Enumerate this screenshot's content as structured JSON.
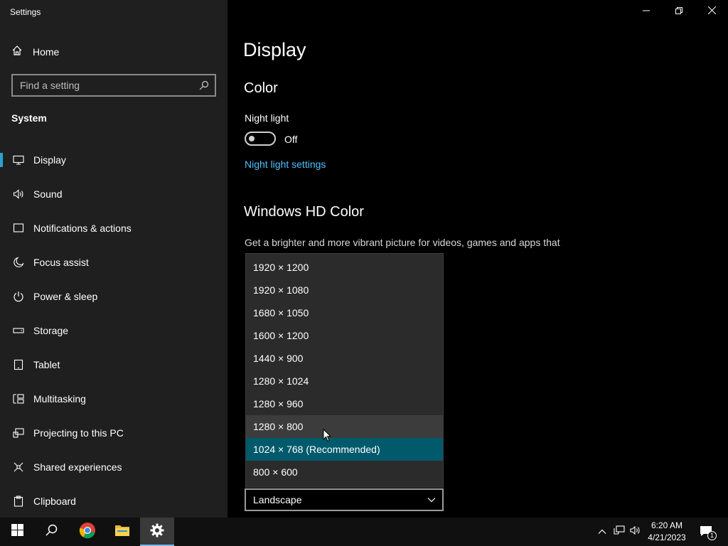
{
  "window": {
    "title": "Settings"
  },
  "sidebar": {
    "home_label": "Home",
    "search_placeholder": "Find a setting",
    "section": "System",
    "items": [
      {
        "label": "Display",
        "icon": "monitor-icon",
        "active": true
      },
      {
        "label": "Sound",
        "icon": "speaker-icon"
      },
      {
        "label": "Notifications & actions",
        "icon": "notification-icon"
      },
      {
        "label": "Focus assist",
        "icon": "moon-icon"
      },
      {
        "label": "Power & sleep",
        "icon": "power-icon"
      },
      {
        "label": "Storage",
        "icon": "storage-icon"
      },
      {
        "label": "Tablet",
        "icon": "tablet-icon"
      },
      {
        "label": "Multitasking",
        "icon": "multitasking-icon"
      },
      {
        "label": "Projecting to this PC",
        "icon": "projecting-icon"
      },
      {
        "label": "Shared experiences",
        "icon": "shared-icon"
      },
      {
        "label": "Clipboard",
        "icon": "clipboard-icon"
      }
    ]
  },
  "main": {
    "title": "Display",
    "color_heading": "Color",
    "night_light_label": "Night light",
    "night_light_state": "Off",
    "night_light_link": "Night light settings",
    "hd_heading": "Windows HD Color",
    "hd_description": "Get a brighter and more vibrant picture for videos, games and apps that"
  },
  "resolution_dropdown": {
    "options": [
      "1920 × 1200",
      "1920 × 1080",
      "1680 × 1050",
      "1600 × 1200",
      "1440 × 900",
      "1280 × 1024",
      "1280 × 960",
      "1280 × 800",
      "1024 × 768 (Recommended)",
      "800 × 600"
    ],
    "hovered_index": 7,
    "selected_index": 8
  },
  "orientation_select": {
    "value": "Landscape"
  },
  "taskbar": {
    "time": "6:20 AM",
    "date": "4/21/2023",
    "notification_count": "1"
  },
  "colors": {
    "accent": "#2da0d0",
    "link": "#4cc2ff",
    "selected_option": "#005a6c",
    "sidebar_bg": "#1f1f1f"
  }
}
